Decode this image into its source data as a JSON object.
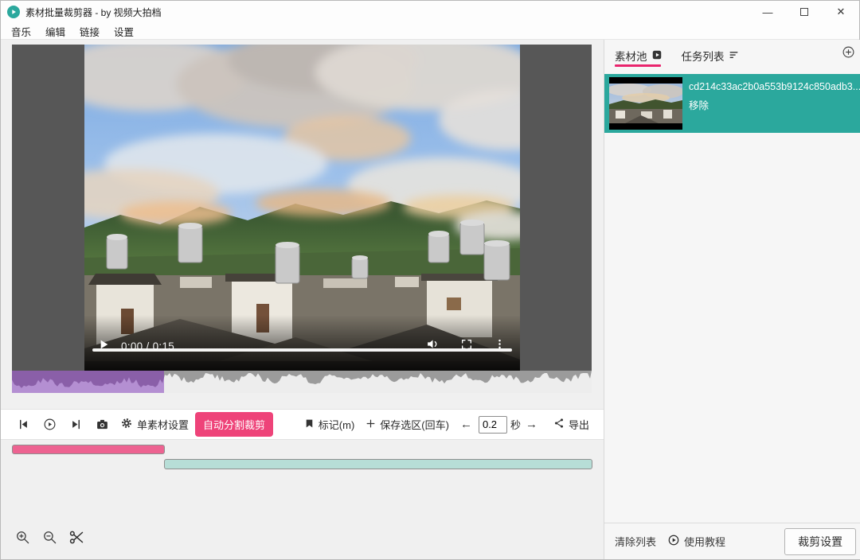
{
  "window": {
    "title": "素材批量裁剪器 - by 视频大拍档",
    "controls": {
      "minimize": "—",
      "close": "✕"
    }
  },
  "menu": {
    "items": [
      {
        "label": "音乐"
      },
      {
        "label": "编辑"
      },
      {
        "label": "链接"
      },
      {
        "label": "设置"
      }
    ]
  },
  "player": {
    "time": "0:00 / 0:15"
  },
  "toolbar": {
    "single_settings_label": "单素材设置",
    "auto_split_label": "自动分割裁剪",
    "mark_label": "标记(m)",
    "save_selection_label": "保存选区(回车)",
    "step_value": "0.2",
    "step_unit": "秒",
    "export_label": "导出"
  },
  "icons": {
    "arrow_left": "←",
    "arrow_right": "→"
  },
  "sidebar": {
    "tabs": [
      {
        "label": "素材池"
      },
      {
        "label": "任务列表"
      }
    ],
    "items": [
      {
        "id": "cd214c33ac2b0a553b9124c850adb3...",
        "remove_label": "移除"
      }
    ],
    "footer": {
      "clear_label": "清除列表",
      "tutorial_label": "使用教程",
      "settings_button": "裁剪设置"
    }
  },
  "colors": {
    "accent_pink": "#ee4379",
    "tab_underline": "#e9246d",
    "item_teal": "#2ba89d",
    "timeline_pink": "#ed6391",
    "timeline_teal": "#b7ded7",
    "wave_sel_bg": "#b48fd2",
    "wave_sel": "#8a5fa8",
    "wave_bg": "#ededed",
    "wave": "#9b9b9b"
  }
}
